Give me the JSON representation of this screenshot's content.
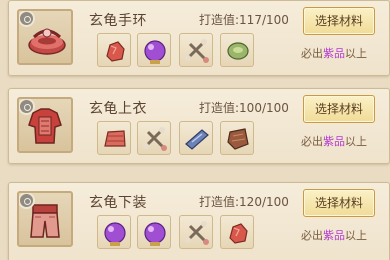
{
  "items": [
    {
      "name": "玄龟手环",
      "score_label": "打造值:",
      "score_value": "117/100",
      "button": "选择材料",
      "hint_prefix": "必出",
      "hint_highlight": "紫品",
      "hint_suffix": "以上",
      "icon": "bracelet-icon",
      "materials": [
        "red-ore-icon",
        "purple-orb-icon",
        "monster-bone-icon",
        "green-gem-icon"
      ]
    },
    {
      "name": "玄龟上衣",
      "score_label": "打造值:",
      "score_value": "100/100",
      "button": "选择材料",
      "hint_prefix": "必出",
      "hint_highlight": "紫品",
      "hint_suffix": "以上",
      "icon": "armor-top-icon",
      "materials": [
        "red-cloth-icon",
        "monster-bone-icon",
        "blue-scroll-icon",
        "brown-hide-icon"
      ]
    },
    {
      "name": "玄龟下装",
      "score_label": "打造值:",
      "score_value": "120/100",
      "button": "选择材料",
      "hint_prefix": "必出",
      "hint_highlight": "紫品",
      "hint_suffix": "以上",
      "icon": "armor-pants-icon",
      "materials": [
        "purple-orb-icon",
        "purple-orb-icon",
        "monster-bone-icon",
        "red-ore-icon"
      ]
    }
  ],
  "colors": {
    "background": "#e9dcc3",
    "card": "#f3e9d5",
    "highlight_purple": "#b43bd1",
    "button": "#f5e2a6"
  }
}
